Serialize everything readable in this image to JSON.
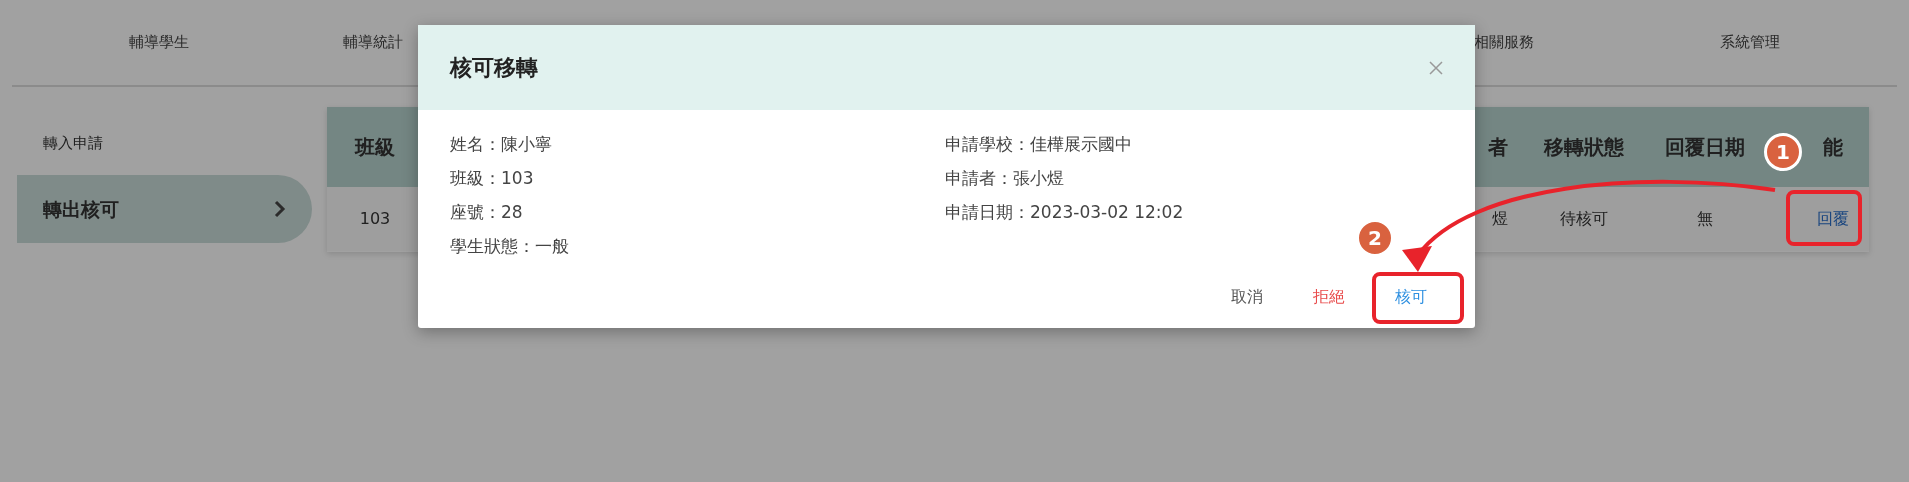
{
  "nav": {
    "tabs": [
      {
        "label": "輔導學生"
      },
      {
        "label": "輔導統計"
      },
      {
        "label": "相關服務"
      },
      {
        "label": "系統管理"
      }
    ]
  },
  "sidebar": {
    "items": [
      {
        "label": "轉入申請",
        "selected": false
      },
      {
        "label": "轉出核可",
        "selected": true
      }
    ]
  },
  "table": {
    "columns": [
      "班級",
      "者",
      "移轉狀態",
      "回覆日期",
      "能"
    ],
    "rows": [
      {
        "cells": [
          "103",
          "煜",
          "待核可",
          "無"
        ],
        "action": "回覆"
      }
    ]
  },
  "modal": {
    "title": "核可移轉",
    "fields_left": [
      "姓名：陳小寧",
      "班級：103",
      "座號：28",
      "學生狀態：一般"
    ],
    "fields_right": [
      "申請學校：佳樺展示國中",
      "申請者：張小煜",
      "申請日期：2023-03-02 12:02"
    ],
    "buttons": [
      {
        "label": "取消",
        "kind": "cancel"
      },
      {
        "label": "拒絕",
        "kind": "reject"
      },
      {
        "label": "核可",
        "kind": "approve"
      }
    ]
  },
  "annotations": [
    {
      "number": "1"
    },
    {
      "number": "2"
    }
  ]
}
